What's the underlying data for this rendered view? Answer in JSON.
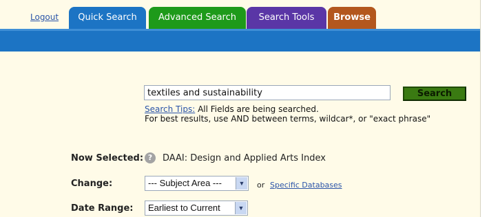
{
  "tabs": {
    "logout": "Logout",
    "quick": "Quick Search",
    "advanced": "Advanced Search",
    "tools": "Search Tools",
    "browse": "Browse"
  },
  "search": {
    "value": "textiles and sustainability",
    "button": "Search",
    "tips_link": "Search Tips:",
    "tips_text": " All Fields are being searched.",
    "tips_line2": "For best results, use AND between terms, wildcar*, or \"exact phrase\""
  },
  "now_selected": {
    "label": "Now Selected:",
    "help_icon": "?",
    "database": "DAAI: Design and Applied Arts Index"
  },
  "change": {
    "label": "Change:",
    "select_value": "--- Subject Area ---",
    "or": "or",
    "specific_link": "Specific Databases"
  },
  "date_range": {
    "label": "Date Range:",
    "select_value": "Earliest to Current"
  },
  "colors": {
    "tab_quick": "#1c74c4",
    "tab_advanced": "#1e9a1a",
    "tab_tools": "#5a36a6",
    "tab_browse": "#b3571d",
    "search_button": "#3a7a12",
    "background": "#fffbe8"
  }
}
